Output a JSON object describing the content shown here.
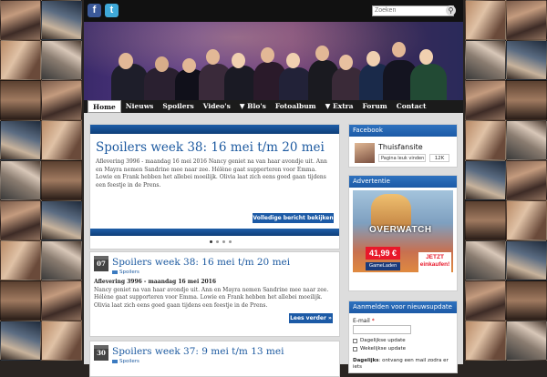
{
  "header": {
    "social": [
      {
        "name": "facebook",
        "glyph": "f"
      },
      {
        "name": "twitter",
        "glyph": "t"
      }
    ],
    "search_placeholder": "Zoeken",
    "search_icon": "magnifier-icon"
  },
  "nav": {
    "items": [
      "Home",
      "Nieuws",
      "Spoilers",
      "Video's",
      "▼ Blo's",
      "Fotoalbum",
      "▼ Extra",
      "Forum",
      "Contact"
    ],
    "active": "Home"
  },
  "slider": {
    "title": "Spoilers week 38: 16 mei t/m 20 mei",
    "text": "Aflevering 3996 - maandag 16 mei 2016 Nancy geniet na van haar avondje uit. Ann en Mayra nemen Sandrine mee naar zee. Hélène gaat supporteren voor Emma. Lowie en Frank hebben het allebei moeilijk. Olivia laat zich eens goed gaan tijdens een feestje in de Prens.",
    "button": "Volledige bericht bekijken"
  },
  "posts": [
    {
      "day": "07",
      "title": "Spoilers week 38: 16 mei t/m 20 mei",
      "category": "Spoilers",
      "lead": "Aflevering 3996 - maandag 16 mei 2016",
      "body": "Nancy geniet na van haar avondje uit. Ann en Mayra nemen Sandrine mee naar zee. Hélène gaat supporteren voor Emma. Lowie en Frank hebben het allebei moeilijk. Olivia laat zich eens goed gaan tijdens een feestje in de Prens.",
      "button": "Lees verder »"
    },
    {
      "day": "30",
      "title": "Spoilers week 37: 9 mei t/m 13 mei",
      "category": "Spoilers"
    }
  ],
  "sidebar": {
    "facebook": {
      "heading": "Facebook",
      "page_name": "Thuisfansite",
      "like_label": "Pagina leuk vinden",
      "like_count": "12K"
    },
    "ad": {
      "heading": "Advertentie",
      "game": "OVERWATCH",
      "price": "41,99 €",
      "shop": "GameLaden",
      "cta": "JETZT einkaufen!"
    },
    "newsletter": {
      "heading": "Aanmelden voor nieuwsupdate",
      "email_label": "E-mail",
      "required_mark": "*",
      "options": [
        "Dagelijkse update",
        "Wekelijkse update"
      ],
      "note_bold": "Dagelijks",
      "note": ": ontvang een mail zodra er iets"
    }
  },
  "colors": {
    "accent": "#1c5aa6",
    "title_blue": "#1d5aa0",
    "nav_bg": "#1b1b1b"
  }
}
